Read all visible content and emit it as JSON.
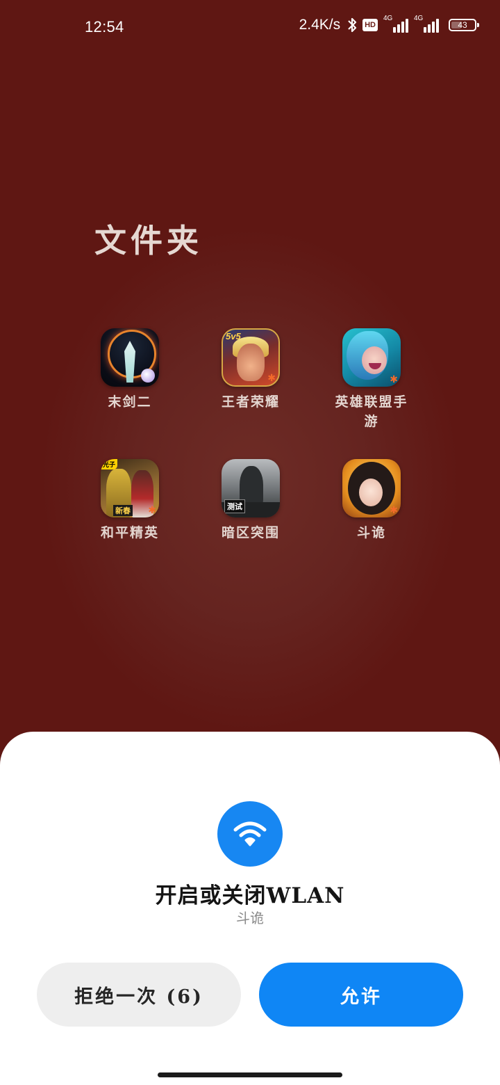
{
  "status_bar": {
    "time": "12:54",
    "net_speed": "2.4K/s",
    "hd_badge": "HD",
    "signal1_tag": "4G",
    "signal2_tag": "4G",
    "battery": "43"
  },
  "folder": {
    "title": "文件夹",
    "apps": [
      {
        "label": "末剑二",
        "icon": "mojian-icon"
      },
      {
        "label": "王者荣耀",
        "icon": "wzry-icon",
        "badge": "5v5"
      },
      {
        "label": "英雄联盟手游",
        "icon": "lol-icon"
      },
      {
        "label": "和平精英",
        "icon": "hpjy-icon",
        "corner_tag": "光子",
        "tag": "新春"
      },
      {
        "label": "暗区突围",
        "icon": "aqtw-icon",
        "tag": "测试"
      },
      {
        "label": "斗诡",
        "icon": "dougui-icon"
      }
    ]
  },
  "dialog": {
    "icon": "wifi-icon",
    "title": "开启或关闭WLAN",
    "subtitle": "斗诡",
    "deny_label": "拒绝一次 (6)",
    "allow_label": "允许",
    "accent_color": "#0f86f5"
  }
}
